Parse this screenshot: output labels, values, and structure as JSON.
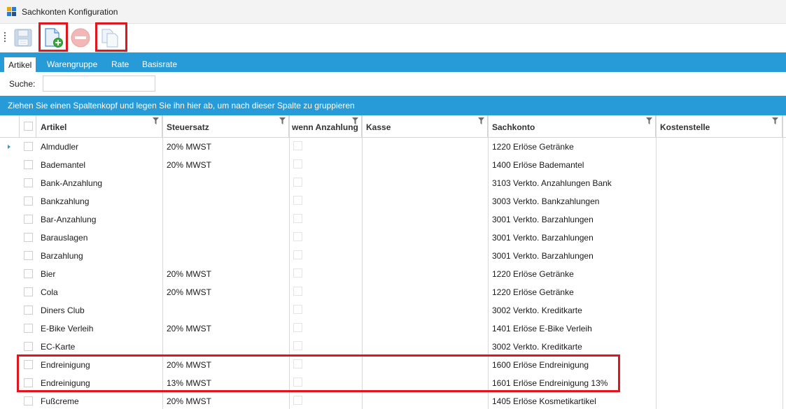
{
  "window": {
    "title": "Sachkonten Konfiguration"
  },
  "toolbar": {
    "buttons": [
      {
        "name": "save-icon",
        "enabled": false
      },
      {
        "name": "new-document-icon",
        "enabled": true
      },
      {
        "name": "delete-icon",
        "enabled": false
      },
      {
        "name": "copy-icon",
        "enabled": false
      }
    ]
  },
  "tabs": [
    {
      "label": "Artikel",
      "active": true
    },
    {
      "label": "Warengruppe",
      "active": false
    },
    {
      "label": "Rate",
      "active": false
    },
    {
      "label": "Basisrate",
      "active": false
    }
  ],
  "search": {
    "label": "Suche:",
    "value": ""
  },
  "group_hint": "Ziehen Sie einen Spaltenkopf und legen Sie ihn hier ab, um nach dieser Spalte zu gruppieren",
  "columns": {
    "artikel": "Artikel",
    "steuersatz": "Steuersatz",
    "anzahlung": "wenn Anzahlung",
    "kasse": "Kasse",
    "sachkonto": "Sachkonto",
    "kostenstelle": "Kostenstelle"
  },
  "rows": [
    {
      "artikel": "Almdudler",
      "steuersatz": "20% MWST",
      "sachkonto": "1220 Erlöse Getränke"
    },
    {
      "artikel": "Bademantel",
      "steuersatz": "20% MWST",
      "sachkonto": "1400 Erlöse Bademantel"
    },
    {
      "artikel": "Bank-Anzahlung",
      "steuersatz": "",
      "sachkonto": "3103 Verkto. Anzahlungen Bank"
    },
    {
      "artikel": "Bankzahlung",
      "steuersatz": "",
      "sachkonto": "3003 Verkto. Bankzahlungen"
    },
    {
      "artikel": "Bar-Anzahlung",
      "steuersatz": "",
      "sachkonto": "3001 Verkto. Barzahlungen"
    },
    {
      "artikel": "Barauslagen",
      "steuersatz": "",
      "sachkonto": "3001 Verkto. Barzahlungen"
    },
    {
      "artikel": "Barzahlung",
      "steuersatz": "",
      "sachkonto": "3001 Verkto. Barzahlungen"
    },
    {
      "artikel": "Bier",
      "steuersatz": "20% MWST",
      "sachkonto": "1220 Erlöse Getränke"
    },
    {
      "artikel": "Cola",
      "steuersatz": "20% MWST",
      "sachkonto": "1220 Erlöse Getränke"
    },
    {
      "artikel": "Diners Club",
      "steuersatz": "",
      "sachkonto": "3002 Verkto. Kreditkarte"
    },
    {
      "artikel": "E-Bike Verleih",
      "steuersatz": "20% MWST",
      "sachkonto": "1401 Erlöse E-Bike Verleih"
    },
    {
      "artikel": "EC-Karte",
      "steuersatz": "",
      "sachkonto": "3002 Verkto. Kreditkarte"
    },
    {
      "artikel": "Endreinigung",
      "steuersatz": "20% MWST",
      "sachkonto": "1600 Erlöse Endreinigung"
    },
    {
      "artikel": "Endreinigung",
      "steuersatz": "13% MWST",
      "sachkonto": "1601 Erlöse Endreinigung 13%"
    },
    {
      "artikel": "Fußcreme",
      "steuersatz": "20% MWST",
      "sachkonto": "1405 Erlöse Kosmetikartikel"
    }
  ],
  "colors": {
    "accent": "#279bd8",
    "highlight": "#e0161f"
  }
}
